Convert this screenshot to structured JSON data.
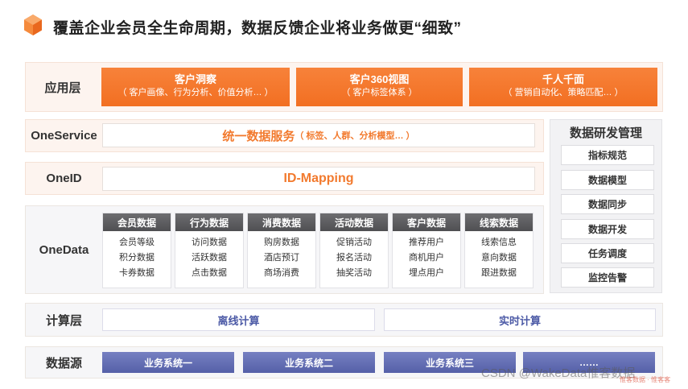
{
  "title": "覆盖企业会员全生命周期，数据反馈企业将业务做更“细致”",
  "colors": {
    "accent": "#f27a2e",
    "card_head": "#58585b",
    "source": "#5f6ab0",
    "calc_text": "#4c5aa6"
  },
  "layers": {
    "app": {
      "label": "应用层",
      "boxes": [
        {
          "title": "客户洞察",
          "sub": "（ 客户画像、行为分析、价值分析… ）"
        },
        {
          "title": "客户360视图",
          "sub": "（ 客户标签体系 ）"
        },
        {
          "title": "千人千面",
          "sub": "（ 营销自动化、策略匹配… ）"
        }
      ]
    },
    "oneservice": {
      "label": "OneService",
      "main": "统一数据服务",
      "sub": "（ 标签、人群、分析模型… ）"
    },
    "oneid": {
      "label": "OneID",
      "main": "ID-Mapping"
    },
    "onedata": {
      "label": "OneData",
      "cards": [
        {
          "head": "会员数据",
          "items": [
            "会员等级",
            "积分数据",
            "卡券数据"
          ]
        },
        {
          "head": "行为数据",
          "items": [
            "访问数据",
            "活跃数据",
            "点击数据"
          ]
        },
        {
          "head": "消费数据",
          "items": [
            "购房数据",
            "酒店预订",
            "商场消费"
          ]
        },
        {
          "head": "活动数据",
          "items": [
            "促销活动",
            "报名活动",
            "抽奖活动"
          ]
        },
        {
          "head": "客户数据",
          "items": [
            "推荐用户",
            "商机用户",
            "埋点用户"
          ]
        },
        {
          "head": "线索数据",
          "items": [
            "线索信息",
            "意向数据",
            "跟进数据"
          ]
        }
      ]
    },
    "compute": {
      "label": "计算层",
      "boxes": [
        "离线计算",
        "实时计算"
      ]
    },
    "source": {
      "label": "数据源",
      "boxes": [
        "业务系统一",
        "业务系统二",
        "业务系统三",
        "……"
      ]
    }
  },
  "management": {
    "title": "数据研发管理",
    "items": [
      "指标规范",
      "数据模型",
      "数据同步",
      "数据开发",
      "任务调度",
      "监控告警"
    ]
  },
  "watermark": "CSDN @WakeData惟客数据",
  "watermark_small": "惟客数据 · 惟客客"
}
